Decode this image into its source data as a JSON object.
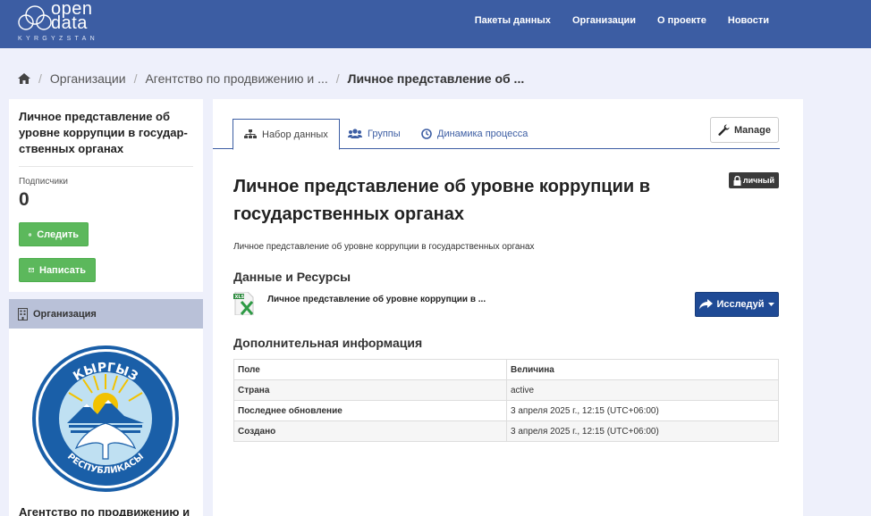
{
  "header": {
    "logo_line1": "open",
    "logo_line2": "data",
    "logo_sub": "KYRGYZSTAN",
    "nav": [
      "Пакеты данных",
      "Организации",
      "О проекте",
      "Новости"
    ]
  },
  "breadcrumb": [
    "Организации",
    "Агентство по продвижению и ...",
    "Личное представление об ..."
  ],
  "sidebar": {
    "title": "Личное представление об уровне коррупции в государ-ственных органах",
    "followers_label": "Подписчики",
    "followers_count": "0",
    "follow_button": "Следить",
    "write_button": "Написать",
    "org_section": "Организация",
    "org_emblem_text_top": "КЫРГЫЗ",
    "org_emblem_text_bottom": "РЕСПУБЛИКАСЫ",
    "org_name": "Агентство по продвижению и"
  },
  "tabs": [
    "Набор данных",
    "Группы",
    "Динамика процесса"
  ],
  "manage_label": "Manage",
  "private_badge": "личный",
  "dataset": {
    "title": "Личное представление об уровне коррупции в государственных органах",
    "notes": "Личное представление об уровне коррупции в государственных органах"
  },
  "resources": {
    "heading": "Данные и Ресурсы",
    "items": [
      {
        "name": "Личное представление об уровне коррупции в ...",
        "format": "XLS"
      }
    ],
    "explore_label": "Исследуй"
  },
  "additional_info": {
    "heading": "Дополнительная информация",
    "columns": [
      "Поле",
      "Величина"
    ],
    "rows": [
      [
        "Страна",
        "active"
      ],
      [
        "Последнее обновление",
        "3 апреля 2025 г., 12:15 (UTC+06:00)"
      ],
      [
        "Создано",
        "3 апреля 2025 г., 12:15 (UTC+06:00)"
      ]
    ]
  },
  "colors": {
    "header": "#3c5da3",
    "follow_green": "#5cb85c",
    "explore_blue": "#1f4a95",
    "background": "#eef0fb"
  }
}
